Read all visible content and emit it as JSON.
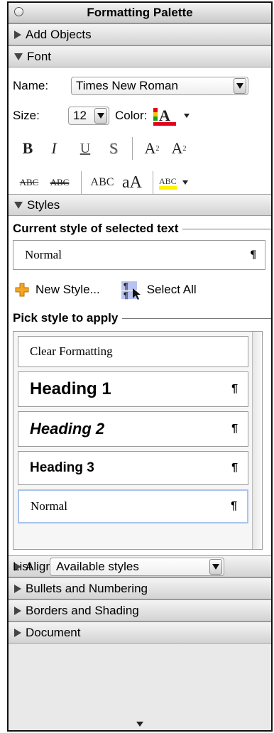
{
  "window": {
    "title": "Formatting Palette"
  },
  "sections": {
    "add_objects": "Add Objects",
    "font": "Font",
    "styles": "Styles",
    "alignment": "Alignment and Spacing",
    "bullets": "Bullets and Numbering",
    "borders": "Borders and Shading",
    "document": "Document"
  },
  "font": {
    "name_label": "Name:",
    "name_value": "Times New Roman",
    "size_label": "Size:",
    "size_value": "12",
    "color_label": "Color:",
    "bold": "B",
    "italic": "I",
    "underline": "U",
    "shadow": "S",
    "superscript": "A",
    "superscript_mark": "2",
    "subscript": "A",
    "subscript_mark": "2",
    "strike": "ABC",
    "double_strike": "ABC",
    "smallcaps": "ABC",
    "changecase": "aA",
    "highlight": "ABC",
    "font_color_swatch": "#e3001b",
    "highlight_swatch": "#fff200"
  },
  "styles": {
    "current_heading": "Current style of selected text",
    "current_style": "Normal",
    "new_style": "New Style...",
    "select_all": "Select All",
    "pick_heading": "Pick style to apply",
    "items": [
      {
        "label": "Clear Formatting",
        "mark": ""
      },
      {
        "label": "Heading 1",
        "mark": "¶"
      },
      {
        "label": "Heading 2",
        "mark": "¶"
      },
      {
        "label": "Heading 3",
        "mark": "¶"
      },
      {
        "label": "Normal",
        "mark": "¶"
      }
    ],
    "pilcrow": "¶",
    "list_label": "List",
    "list_value": "Available styles"
  }
}
